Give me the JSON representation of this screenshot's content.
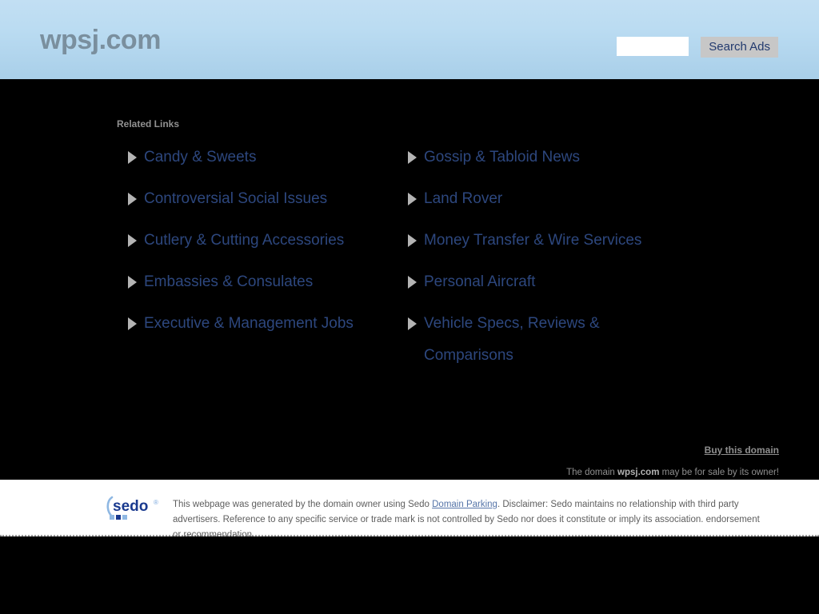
{
  "header": {
    "domain_title": "wpsj.com",
    "search": {
      "input_value": "",
      "placeholder": "",
      "button_label": "Search Ads"
    }
  },
  "main": {
    "related_links_label": "Related Links",
    "columns": [
      {
        "items": [
          {
            "label": "Candy & Sweets"
          },
          {
            "label": "Controversial Social Issues"
          },
          {
            "label": "Cutlery & Cutting Accessories"
          },
          {
            "label": "Embassies & Consulates"
          },
          {
            "label": "Executive & Management Jobs"
          }
        ]
      },
      {
        "items": [
          {
            "label": "Gossip & Tabloid News"
          },
          {
            "label": "Land Rover"
          },
          {
            "label": "Money Transfer & Wire Services"
          },
          {
            "label": "Personal Aircraft"
          },
          {
            "label": "Vehicle Specs, Reviews & Comparisons"
          }
        ]
      }
    ]
  },
  "buy": {
    "link_label": "Buy this domain",
    "note_prefix": "The domain ",
    "note_domain": "wpsj.com",
    "note_suffix": " may be for sale by its owner!"
  },
  "footer": {
    "logo_word": "sedo",
    "logo_trademark": "®",
    "text_part1": "This webpage was generated by the domain owner using Sedo ",
    "text_link": "Domain Parking",
    "text_part2": ". Disclaimer: Sedo maintains no relationship with third party advertisers. Reference to any specific service or trade mark is not controlled by Sedo nor does it constitute or imply its association. endorsement or recommendation."
  },
  "colors": {
    "header_gradient_top": "#c2dff3",
    "header_gradient_bottom": "#a9cfe9",
    "page_background": "#000000",
    "link_blue": "#2d477e",
    "bullet_grey": "#b4b4b4",
    "label_grey": "#919191",
    "title_grey": "#7a8f9e",
    "button_grey": "#c7c7c7",
    "button_text": "#223a6e",
    "sedo_blue": "#1a3a8f",
    "sedo_light_blue": "#7aa7dd",
    "footer_link_blue": "#5574a8"
  }
}
